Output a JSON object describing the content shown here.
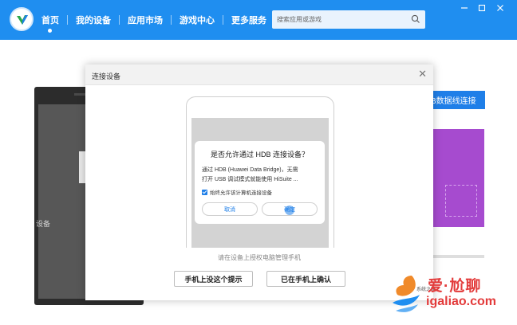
{
  "topbar": {
    "nav": [
      {
        "label": "首页"
      },
      {
        "label": "我的设备"
      },
      {
        "label": "应用市场"
      },
      {
        "label": "游戏中心"
      },
      {
        "label": "更多服务"
      }
    ],
    "search_placeholder": "搜索应用或游戏",
    "window_controls": [
      "minimize",
      "restore",
      "close"
    ]
  },
  "background": {
    "device_text": "设备",
    "connect_button": "B数据线连接"
  },
  "dialog": {
    "title": "连接设备",
    "permission": {
      "title": "是否允许通过 HDB 连接设备？",
      "body_line1": "通过 HDB (Huawei Data Bridge)，无需",
      "body_line2": "打开 USB 调试模式就能使用 HiSuite ...",
      "checkbox_label": "始终允许该计算机连接设备",
      "cancel": "取消",
      "allow": "确定"
    },
    "hint": "请在设备上授权电脑管理手机",
    "button_no_prompt": "手机上没这个提示",
    "button_confirmed": "已在手机上确认"
  },
  "watermark": {
    "cn": "爱·尬聊",
    "en": "igaliao.com",
    "small": "系统之家"
  }
}
